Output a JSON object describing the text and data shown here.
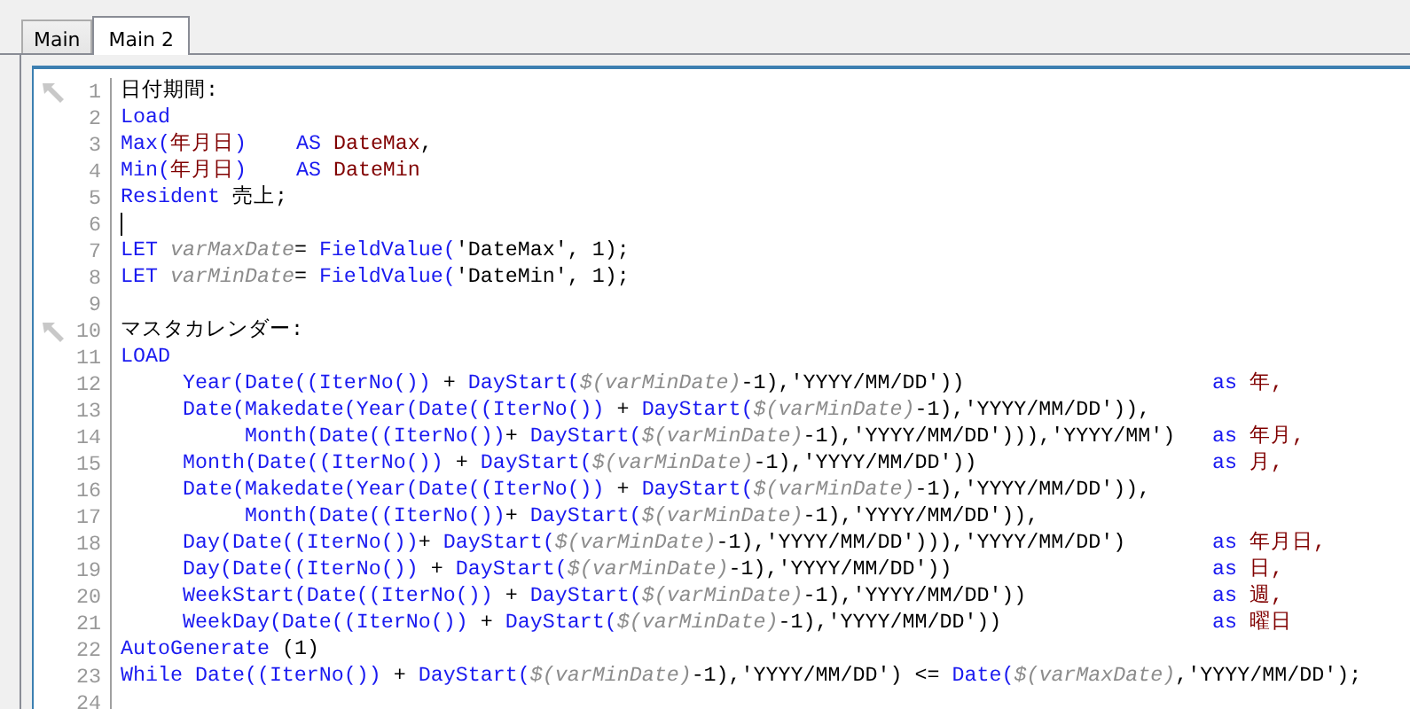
{
  "tabs": [
    {
      "label": "Main",
      "selected": false
    },
    {
      "label": "Main 2",
      "selected": true
    }
  ],
  "editor": {
    "lines": [
      {
        "number": "1",
        "bookmark": true,
        "cursor": false,
        "tokens": [
          {
            "kind": "text",
            "text": "日付期間:"
          }
        ]
      },
      {
        "number": "2",
        "bookmark": false,
        "cursor": false,
        "tokens": [
          {
            "kind": "kw",
            "text": "Load"
          }
        ]
      },
      {
        "number": "3",
        "bookmark": false,
        "cursor": false,
        "tokens": [
          {
            "kind": "kw",
            "text": "Max("
          },
          {
            "kind": "field",
            "text": "年月日"
          },
          {
            "kind": "kw",
            "text": ")    AS "
          },
          {
            "kind": "field",
            "text": "DateMax"
          },
          {
            "kind": "text",
            "text": ","
          }
        ]
      },
      {
        "number": "4",
        "bookmark": false,
        "cursor": false,
        "tokens": [
          {
            "kind": "kw",
            "text": "Min("
          },
          {
            "kind": "field",
            "text": "年月日"
          },
          {
            "kind": "kw",
            "text": ")    AS "
          },
          {
            "kind": "field",
            "text": "DateMin"
          }
        ]
      },
      {
        "number": "5",
        "bookmark": false,
        "cursor": false,
        "tokens": [
          {
            "kind": "kw",
            "text": "Resident"
          },
          {
            "kind": "text",
            "text": " 売上;"
          }
        ]
      },
      {
        "number": "6",
        "bookmark": false,
        "cursor": true
      },
      {
        "number": "7",
        "bookmark": false,
        "cursor": false,
        "tokens": [
          {
            "kind": "kw",
            "text": "LET "
          },
          {
            "kind": "var",
            "text": "varMaxDate"
          },
          {
            "kind": "text",
            "text": "= "
          },
          {
            "kind": "kw",
            "text": "FieldValue("
          },
          {
            "kind": "text",
            "text": "'DateMax', 1);"
          }
        ]
      },
      {
        "number": "8",
        "bookmark": false,
        "cursor": false,
        "tokens": [
          {
            "kind": "kw",
            "text": "LET "
          },
          {
            "kind": "var",
            "text": "varMinDate"
          },
          {
            "kind": "text",
            "text": "= "
          },
          {
            "kind": "kw",
            "text": "FieldValue("
          },
          {
            "kind": "text",
            "text": "'DateMin', 1);"
          }
        ]
      },
      {
        "number": "9",
        "bookmark": false,
        "cursor": false
      },
      {
        "number": "10",
        "bookmark": true,
        "cursor": false,
        "tokens": [
          {
            "kind": "text",
            "text": "マスタカレンダー:"
          }
        ]
      },
      {
        "number": "11",
        "bookmark": false,
        "cursor": false,
        "tokens": [
          {
            "kind": "kw",
            "text": "LOAD"
          }
        ]
      },
      {
        "number": "12",
        "bookmark": false,
        "cursor": false,
        "tokens": [
          {
            "kind": "kw",
            "text": "     Year(Date((IterNo())"
          },
          {
            "kind": "text",
            "text": " + "
          },
          {
            "kind": "kw",
            "text": "DayStart("
          },
          {
            "kind": "var",
            "text": "$(varMinDate)"
          },
          {
            "kind": "text",
            "text": "-1),'YYYY/MM/DD'))"
          }
        ],
        "alias": {
          "keyword": "as",
          "name": "年,"
        }
      },
      {
        "number": "13",
        "bookmark": false,
        "cursor": false,
        "tokens": [
          {
            "kind": "kw",
            "text": "     Date(Makedate(Year(Date((IterNo())"
          },
          {
            "kind": "text",
            "text": " + "
          },
          {
            "kind": "kw",
            "text": "DayStart("
          },
          {
            "kind": "var",
            "text": "$(varMinDate)"
          },
          {
            "kind": "text",
            "text": "-1),'YYYY/MM/DD')),"
          }
        ]
      },
      {
        "number": "14",
        "bookmark": false,
        "cursor": false,
        "tokens": [
          {
            "kind": "kw",
            "text": "          Month(Date((IterNo())"
          },
          {
            "kind": "text",
            "text": "+ "
          },
          {
            "kind": "kw",
            "text": "DayStart("
          },
          {
            "kind": "var",
            "text": "$(varMinDate)"
          },
          {
            "kind": "text",
            "text": "-1),'YYYY/MM/DD'))),'YYYY/MM')"
          }
        ],
        "alias": {
          "keyword": "as",
          "name": "年月,"
        }
      },
      {
        "number": "15",
        "bookmark": false,
        "cursor": false,
        "tokens": [
          {
            "kind": "kw",
            "text": "     Month(Date((IterNo())"
          },
          {
            "kind": "text",
            "text": " + "
          },
          {
            "kind": "kw",
            "text": "DayStart("
          },
          {
            "kind": "var",
            "text": "$(varMinDate)"
          },
          {
            "kind": "text",
            "text": "-1),'YYYY/MM/DD'))"
          }
        ],
        "alias": {
          "keyword": "as",
          "name": "月,"
        }
      },
      {
        "number": "16",
        "bookmark": false,
        "cursor": false,
        "tokens": [
          {
            "kind": "kw",
            "text": "     Date(Makedate(Year(Date((IterNo())"
          },
          {
            "kind": "text",
            "text": " + "
          },
          {
            "kind": "kw",
            "text": "DayStart("
          },
          {
            "kind": "var",
            "text": "$(varMinDate)"
          },
          {
            "kind": "text",
            "text": "-1),'YYYY/MM/DD')),"
          }
        ]
      },
      {
        "number": "17",
        "bookmark": false,
        "cursor": false,
        "tokens": [
          {
            "kind": "kw",
            "text": "          Month(Date((IterNo())"
          },
          {
            "kind": "text",
            "text": "+ "
          },
          {
            "kind": "kw",
            "text": "DayStart("
          },
          {
            "kind": "var",
            "text": "$(varMinDate)"
          },
          {
            "kind": "text",
            "text": "-1),'YYYY/MM/DD')),"
          }
        ]
      },
      {
        "number": "18",
        "bookmark": false,
        "cursor": false,
        "tokens": [
          {
            "kind": "kw",
            "text": "     Day(Date((IterNo())"
          },
          {
            "kind": "text",
            "text": "+ "
          },
          {
            "kind": "kw",
            "text": "DayStart("
          },
          {
            "kind": "var",
            "text": "$(varMinDate)"
          },
          {
            "kind": "text",
            "text": "-1),'YYYY/MM/DD'))),'YYYY/MM/DD')"
          }
        ],
        "alias": {
          "keyword": "as",
          "name": "年月日,"
        }
      },
      {
        "number": "19",
        "bookmark": false,
        "cursor": false,
        "tokens": [
          {
            "kind": "kw",
            "text": "     Day(Date((IterNo())"
          },
          {
            "kind": "text",
            "text": " + "
          },
          {
            "kind": "kw",
            "text": "DayStart("
          },
          {
            "kind": "var",
            "text": "$(varMinDate)"
          },
          {
            "kind": "text",
            "text": "-1),'YYYY/MM/DD'))"
          }
        ],
        "alias": {
          "keyword": "as",
          "name": "日,"
        }
      },
      {
        "number": "20",
        "bookmark": false,
        "cursor": false,
        "tokens": [
          {
            "kind": "kw",
            "text": "     WeekStart(Date((IterNo())"
          },
          {
            "kind": "text",
            "text": " + "
          },
          {
            "kind": "kw",
            "text": "DayStart("
          },
          {
            "kind": "var",
            "text": "$(varMinDate)"
          },
          {
            "kind": "text",
            "text": "-1),'YYYY/MM/DD'))"
          }
        ],
        "alias": {
          "keyword": "as",
          "name": "週,"
        }
      },
      {
        "number": "21",
        "bookmark": false,
        "cursor": false,
        "tokens": [
          {
            "kind": "kw",
            "text": "     WeekDay(Date((IterNo())"
          },
          {
            "kind": "text",
            "text": " + "
          },
          {
            "kind": "kw",
            "text": "DayStart("
          },
          {
            "kind": "var",
            "text": "$(varMinDate)"
          },
          {
            "kind": "text",
            "text": "-1),'YYYY/MM/DD'))"
          }
        ],
        "alias": {
          "keyword": "as",
          "name": "曜日"
        }
      },
      {
        "number": "22",
        "bookmark": false,
        "cursor": false,
        "tokens": [
          {
            "kind": "kw",
            "text": "AutoGenerate"
          },
          {
            "kind": "text",
            "text": " (1)"
          }
        ]
      },
      {
        "number": "23",
        "bookmark": false,
        "cursor": false,
        "tokens": [
          {
            "kind": "kw",
            "text": "While Date((IterNo())"
          },
          {
            "kind": "text",
            "text": " + "
          },
          {
            "kind": "kw",
            "text": "DayStart("
          },
          {
            "kind": "var",
            "text": "$(varMinDate)"
          },
          {
            "kind": "text",
            "text": "-1),'YYYY/MM/DD') <= "
          },
          {
            "kind": "kw",
            "text": "Date("
          },
          {
            "kind": "var",
            "text": "$(varMaxDate)"
          },
          {
            "kind": "text",
            "text": ",'YYYY/MM/DD');"
          }
        ]
      },
      {
        "number": "24",
        "bookmark": false,
        "cursor": false
      }
    ]
  }
}
